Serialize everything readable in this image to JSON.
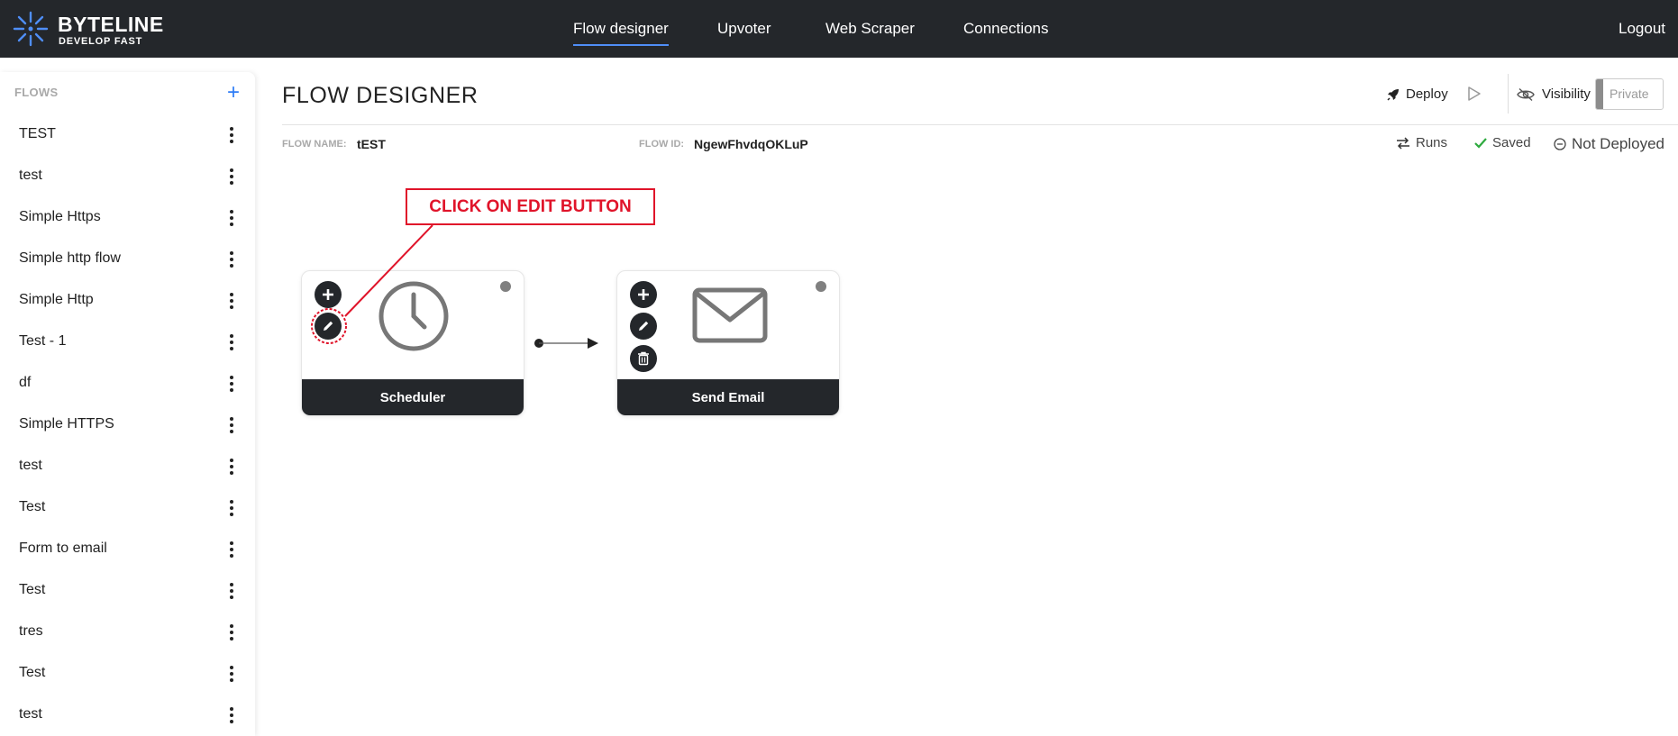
{
  "brand": {
    "title": "BYTELINE",
    "subtitle": "DEVELOP FAST",
    "accent": "#4f8ef7"
  },
  "nav": {
    "items": [
      {
        "label": "Flow designer",
        "active": true
      },
      {
        "label": "Upvoter"
      },
      {
        "label": "Web Scraper"
      },
      {
        "label": "Connections"
      }
    ],
    "logout": "Logout"
  },
  "sidebar": {
    "title": "FLOWS",
    "add_icon": "plus-icon",
    "items": [
      {
        "label": "TEST"
      },
      {
        "label": "test"
      },
      {
        "label": "Simple Https"
      },
      {
        "label": "Simple http flow"
      },
      {
        "label": "Simple Http"
      },
      {
        "label": "Test - 1"
      },
      {
        "label": "df"
      },
      {
        "label": "Simple HTTPS"
      },
      {
        "label": "test"
      },
      {
        "label": "Test"
      },
      {
        "label": "Form to email"
      },
      {
        "label": "Test"
      },
      {
        "label": "tres"
      },
      {
        "label": "Test"
      },
      {
        "label": "test"
      }
    ]
  },
  "header": {
    "title": "FLOW DESIGNER",
    "deploy": "Deploy",
    "visibility": "Visibility",
    "visibility_value": "Private"
  },
  "meta": {
    "flow_name_label": "FLOW NAME:",
    "flow_name": "tEST",
    "flow_id_label": "FLOW ID:",
    "flow_id": "NgewFhvdqOKLuP",
    "runs": "Runs",
    "saved": "Saved",
    "deploy_status": "Not Deployed",
    "saved_color": "#2eaa3f"
  },
  "nodes": [
    {
      "label": "Scheduler",
      "icon": "clock-icon"
    },
    {
      "label": "Send Email",
      "icon": "envelope-icon"
    }
  ],
  "annotation": {
    "text": "CLICK ON EDIT BUTTON",
    "color": "#e0142a"
  }
}
